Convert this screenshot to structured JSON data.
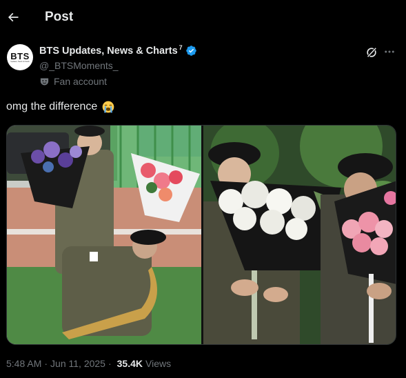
{
  "header": {
    "title": "Post"
  },
  "author": {
    "avatar_text": "BTS",
    "avatar_subtext": "Updates, News & Charts",
    "display_name": "BTS Updates, News & Charts",
    "name_suffix": "7",
    "handle": "@_BTSMoments_",
    "account_label": "Fan account",
    "verified_color": "#1d9bf0"
  },
  "post": {
    "text": "omg the difference",
    "emoji": "loudly-crying-face"
  },
  "meta": {
    "time": "5:48 AM",
    "date": "Jun 11, 2025",
    "views_count": "35.4K",
    "views_label": "Views"
  },
  "colors": {
    "background": "#000000",
    "text_primary": "#e7e9ea",
    "text_secondary": "#71767b",
    "border": "#2f3336",
    "accent": "#1d9bf0"
  }
}
